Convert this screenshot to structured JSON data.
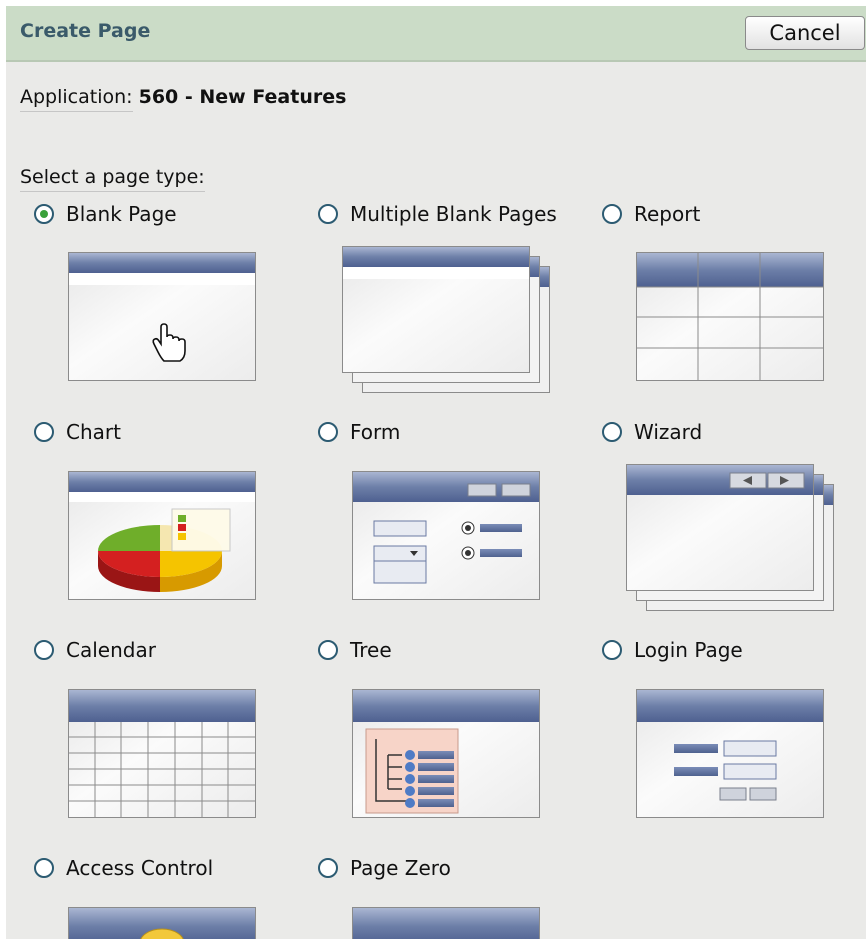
{
  "header": {
    "title": "Create Page",
    "cancel_label": "Cancel"
  },
  "application": {
    "label": "Application:",
    "value": "560 - New Features"
  },
  "select_label": "Select a page type:",
  "page_types": [
    {
      "label": "Blank Page",
      "icon": "blank-page-thumbnail",
      "selected": true
    },
    {
      "label": "Multiple Blank Pages",
      "icon": "multiple-blank-pages-thumbnail",
      "selected": false
    },
    {
      "label": "Report",
      "icon": "report-thumbnail",
      "selected": false
    },
    {
      "label": "Chart",
      "icon": "chart-thumbnail",
      "selected": false
    },
    {
      "label": "Form",
      "icon": "form-thumbnail",
      "selected": false
    },
    {
      "label": "Wizard",
      "icon": "wizard-thumbnail",
      "selected": false
    },
    {
      "label": "Calendar",
      "icon": "calendar-thumbnail",
      "selected": false
    },
    {
      "label": "Tree",
      "icon": "tree-thumbnail",
      "selected": false
    },
    {
      "label": "Login Page",
      "icon": "login-page-thumbnail",
      "selected": false
    },
    {
      "label": "Access Control",
      "icon": "access-control-thumbnail",
      "selected": false
    },
    {
      "label": "Page Zero",
      "icon": "page-zero-thumbnail",
      "selected": false
    }
  ],
  "colors": {
    "header_bg": "#cbdcc7",
    "title_bar": "#5a6e9a",
    "selected_radio": "#3aa03a"
  }
}
